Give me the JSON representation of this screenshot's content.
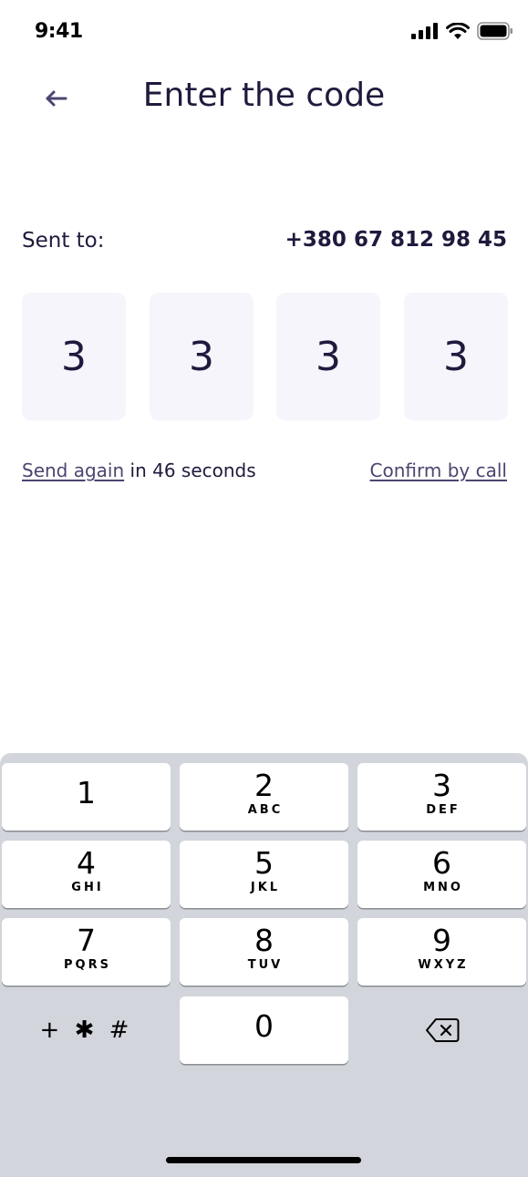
{
  "status_bar": {
    "time": "9:41"
  },
  "header": {
    "title": "Enter the code",
    "back_icon": "arrow-left-icon"
  },
  "sent": {
    "label": "Sent to:",
    "phone": "+380 67 812 98 45"
  },
  "code": {
    "digits": [
      "3",
      "3",
      "3",
      "3"
    ]
  },
  "resend": {
    "link_label": "Send again",
    "countdown_text": " in 46 seconds",
    "confirm_call_label": "Confirm by call"
  },
  "keyboard": {
    "keys": [
      {
        "num": "1",
        "letters": ""
      },
      {
        "num": "2",
        "letters": "ABC"
      },
      {
        "num": "3",
        "letters": "DEF"
      },
      {
        "num": "4",
        "letters": "GHI"
      },
      {
        "num": "5",
        "letters": "JKL"
      },
      {
        "num": "6",
        "letters": "MNO"
      },
      {
        "num": "7",
        "letters": "PQRS"
      },
      {
        "num": "8",
        "letters": "TUV"
      },
      {
        "num": "9",
        "letters": "WXYZ"
      },
      {
        "num": "0",
        "letters": ""
      }
    ],
    "symbols_label": "+ ✱ #",
    "delete_icon": "backspace-icon"
  },
  "colors": {
    "primary_text": "#1f1a3d",
    "link": "#4b4570",
    "code_box_bg": "#f5f5fb",
    "keyboard_bg": "#d2d5db"
  }
}
